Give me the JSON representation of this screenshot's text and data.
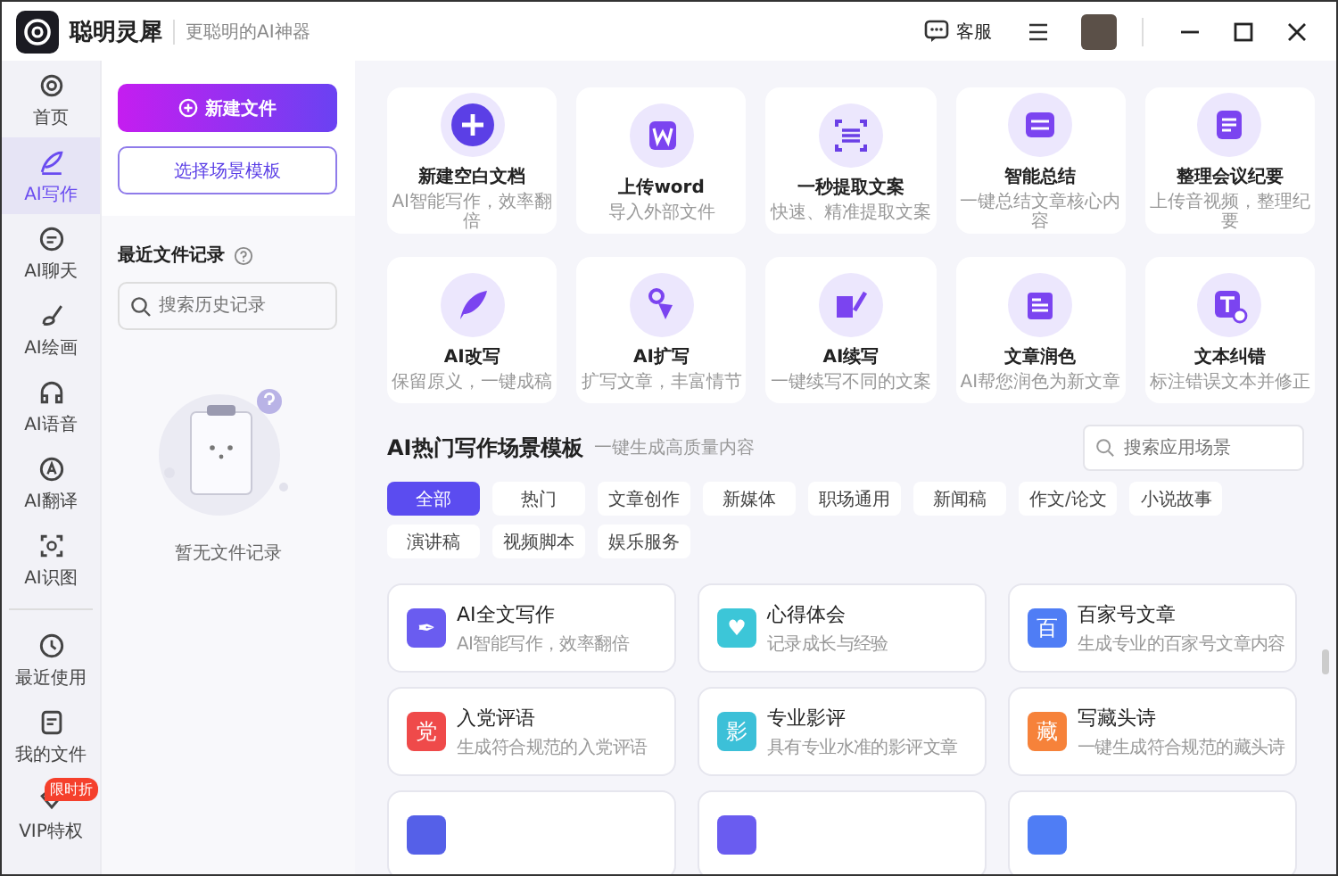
{
  "window": {
    "app_name": "聪明灵犀",
    "tagline": "更聪明的AI神器",
    "support": "客服"
  },
  "nav": [
    {
      "label": "首页",
      "selected": false
    },
    {
      "label": "AI写作",
      "selected": true
    },
    {
      "label": "AI聊天",
      "selected": false
    },
    {
      "label": "AI绘画",
      "selected": false
    },
    {
      "label": "AI语音",
      "selected": false
    },
    {
      "label": "AI翻译",
      "selected": false
    },
    {
      "label": "AI识图",
      "selected": false
    }
  ],
  "nav_bottom": [
    {
      "label": "最近使用"
    },
    {
      "label": "我的文件"
    },
    {
      "label": "VIP特权",
      "badge": "限时折"
    }
  ],
  "panel": {
    "new_file": "新建文件",
    "template": "选择场景模板",
    "recent_title": "最近文件记录",
    "search_placeholder": "搜索历史记录",
    "empty": "暂无文件记录"
  },
  "tools": [
    {
      "title": "新建空白文档",
      "desc": "AI智能写作，效率翻倍"
    },
    {
      "title": "上传word",
      "desc": "导入外部文件"
    },
    {
      "title": "一秒提取文案",
      "desc": "快速、精准提取文案"
    },
    {
      "title": "智能总结",
      "desc": "一键总结文章核心内容"
    },
    {
      "title": "整理会议纪要",
      "desc": "上传音视频，整理纪要"
    },
    {
      "title": "AI改写",
      "desc": "保留原义，一键成稿"
    },
    {
      "title": "AI扩写",
      "desc": "扩写文章，丰富情节"
    },
    {
      "title": "AI续写",
      "desc": "一键续写不同的文案"
    },
    {
      "title": "文章润色",
      "desc": "AI帮您润色为新文章"
    },
    {
      "title": "文本纠错",
      "desc": "标注错误文本并修正"
    }
  ],
  "templates_section": {
    "title": "AI热门写作场景模板",
    "subtitle": "一键生成高质量内容",
    "search_placeholder": "搜索应用场景"
  },
  "chips": [
    {
      "label": "全部",
      "selected": true
    },
    {
      "label": "热门",
      "selected": false
    },
    {
      "label": "文章创作",
      "selected": false
    },
    {
      "label": "新媒体",
      "selected": false
    },
    {
      "label": "职场通用",
      "selected": false
    },
    {
      "label": "新闻稿",
      "selected": false
    },
    {
      "label": "作文/论文",
      "selected": false
    },
    {
      "label": "小说故事",
      "selected": false
    },
    {
      "label": "演讲稿",
      "selected": false
    },
    {
      "label": "视频脚本",
      "selected": false
    },
    {
      "label": "娱乐服务",
      "selected": false
    }
  ],
  "templates": [
    {
      "title": "AI全文写作",
      "desc": "AI智能写作，效率翻倍",
      "color": "#6a5cf0",
      "glyph": "✒"
    },
    {
      "title": "心得体会",
      "desc": "记录成长与经验",
      "color": "#3cc6d8",
      "glyph": "♥"
    },
    {
      "title": "百家号文章",
      "desc": "生成专业的百家号文章内容",
      "color": "#4f7df5",
      "glyph": "百"
    },
    {
      "title": "入党评语",
      "desc": "生成符合规范的入党评语",
      "color": "#ef4a4a",
      "glyph": "党"
    },
    {
      "title": "专业影评",
      "desc": "具有专业水准的影评文章",
      "color": "#3cc0d8",
      "glyph": "影"
    },
    {
      "title": "写藏头诗",
      "desc": "一键生成符合规范的藏头诗",
      "color": "#f6823a",
      "glyph": "藏"
    },
    {
      "color": "#5560e8"
    },
    {
      "color": "#6a5cf0"
    },
    {
      "color": "#4f7df5"
    }
  ]
}
